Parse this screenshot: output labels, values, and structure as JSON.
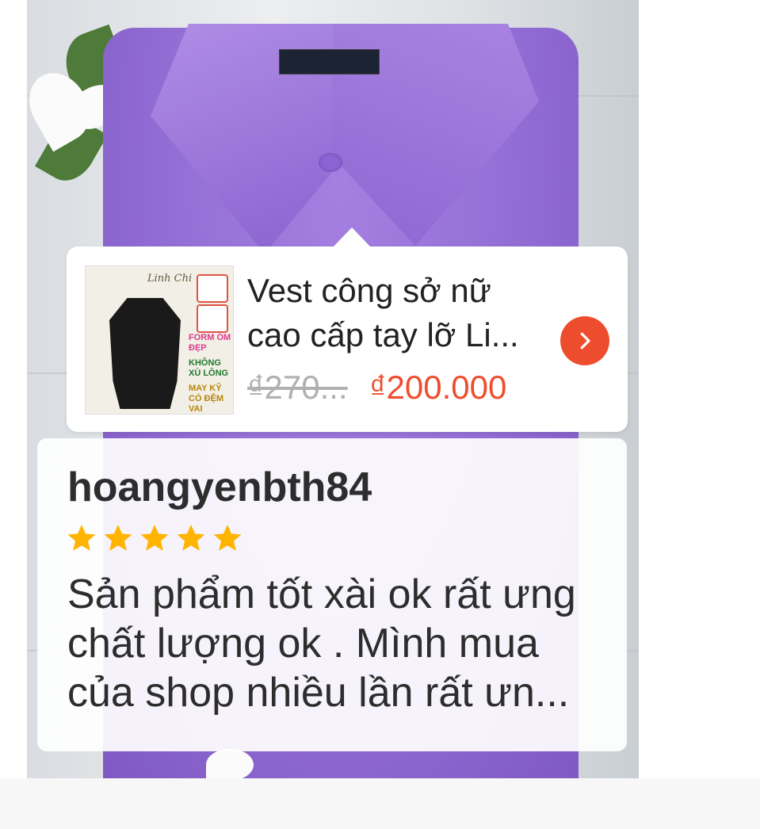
{
  "product": {
    "title": "Vest công sở nữ cao cấp tay lỡ Li...",
    "thumbnail_signature": "Linh Chi",
    "thumbnail_promo": [
      "FORM ÔM ĐẸP",
      "KHÔNG XÙ LÔNG",
      "MAY KỸ CÓ ĐỆM VAI"
    ],
    "price_original": "₫270...",
    "price_current": "₫200.000",
    "go_icon": "chevron-right-icon"
  },
  "review": {
    "username": "hoangyenbth84",
    "rating": 5,
    "rating_max": 5,
    "star_icon": "star-icon",
    "comment": "Sản phẩm tốt xài ok rất ưng chất lượng ok . Mình mua của shop nhiều lần rất ưn..."
  },
  "colors": {
    "accent": "#ee4d2d",
    "star": "#ffb400",
    "text": "#2d2d2d",
    "muted": "#b0b0b0"
  }
}
